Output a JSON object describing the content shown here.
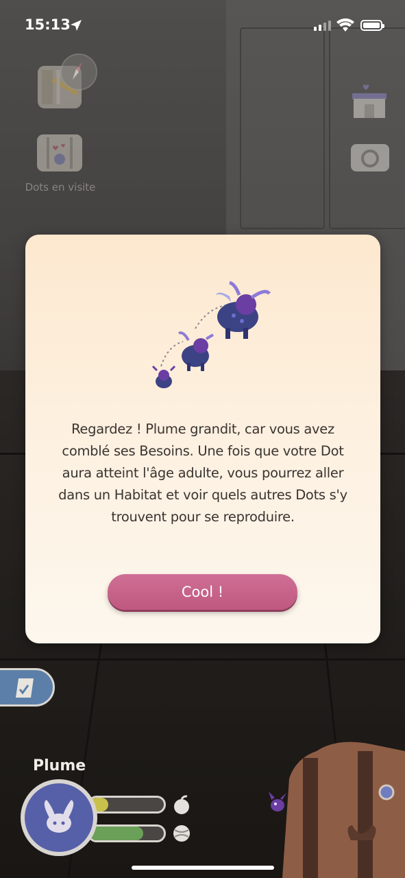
{
  "status_bar": {
    "time": "15:13",
    "icons": [
      "location-arrow-icon",
      "cellular-signal-icon",
      "wifi-icon",
      "battery-icon"
    ]
  },
  "hud": {
    "visit_label": "Dots en visite",
    "icons": [
      "map-icon",
      "compass-icon",
      "suitcase-icon",
      "shop-icon",
      "camera-icon"
    ]
  },
  "modal": {
    "message": "Regardez ! Plume grandit, car vous avez comblé ses Besoins. Une fois que votre Dot aura atteint l'âge adulte, vous pourrez aller dans un Habitat et voir quels autres Dots s'y trouvent pour se reproduire.",
    "button_label": "Cool !",
    "illustration": "dot-growth-stages-icon"
  },
  "pet": {
    "name": "Plume",
    "needs": [
      {
        "name": "food",
        "icon": "fruit-icon",
        "level": 0.25
      },
      {
        "name": "play",
        "icon": "ball-icon",
        "level": 0.72
      }
    ]
  },
  "colors": {
    "button": "#c9638a",
    "modal_top": "#fde8cf",
    "modal_bottom": "#fdf7ee",
    "food_bar": "#c8c24c",
    "play_bar": "#6aa058",
    "avatar": "#5660a8",
    "quest_tab": "#5b7fa8"
  }
}
